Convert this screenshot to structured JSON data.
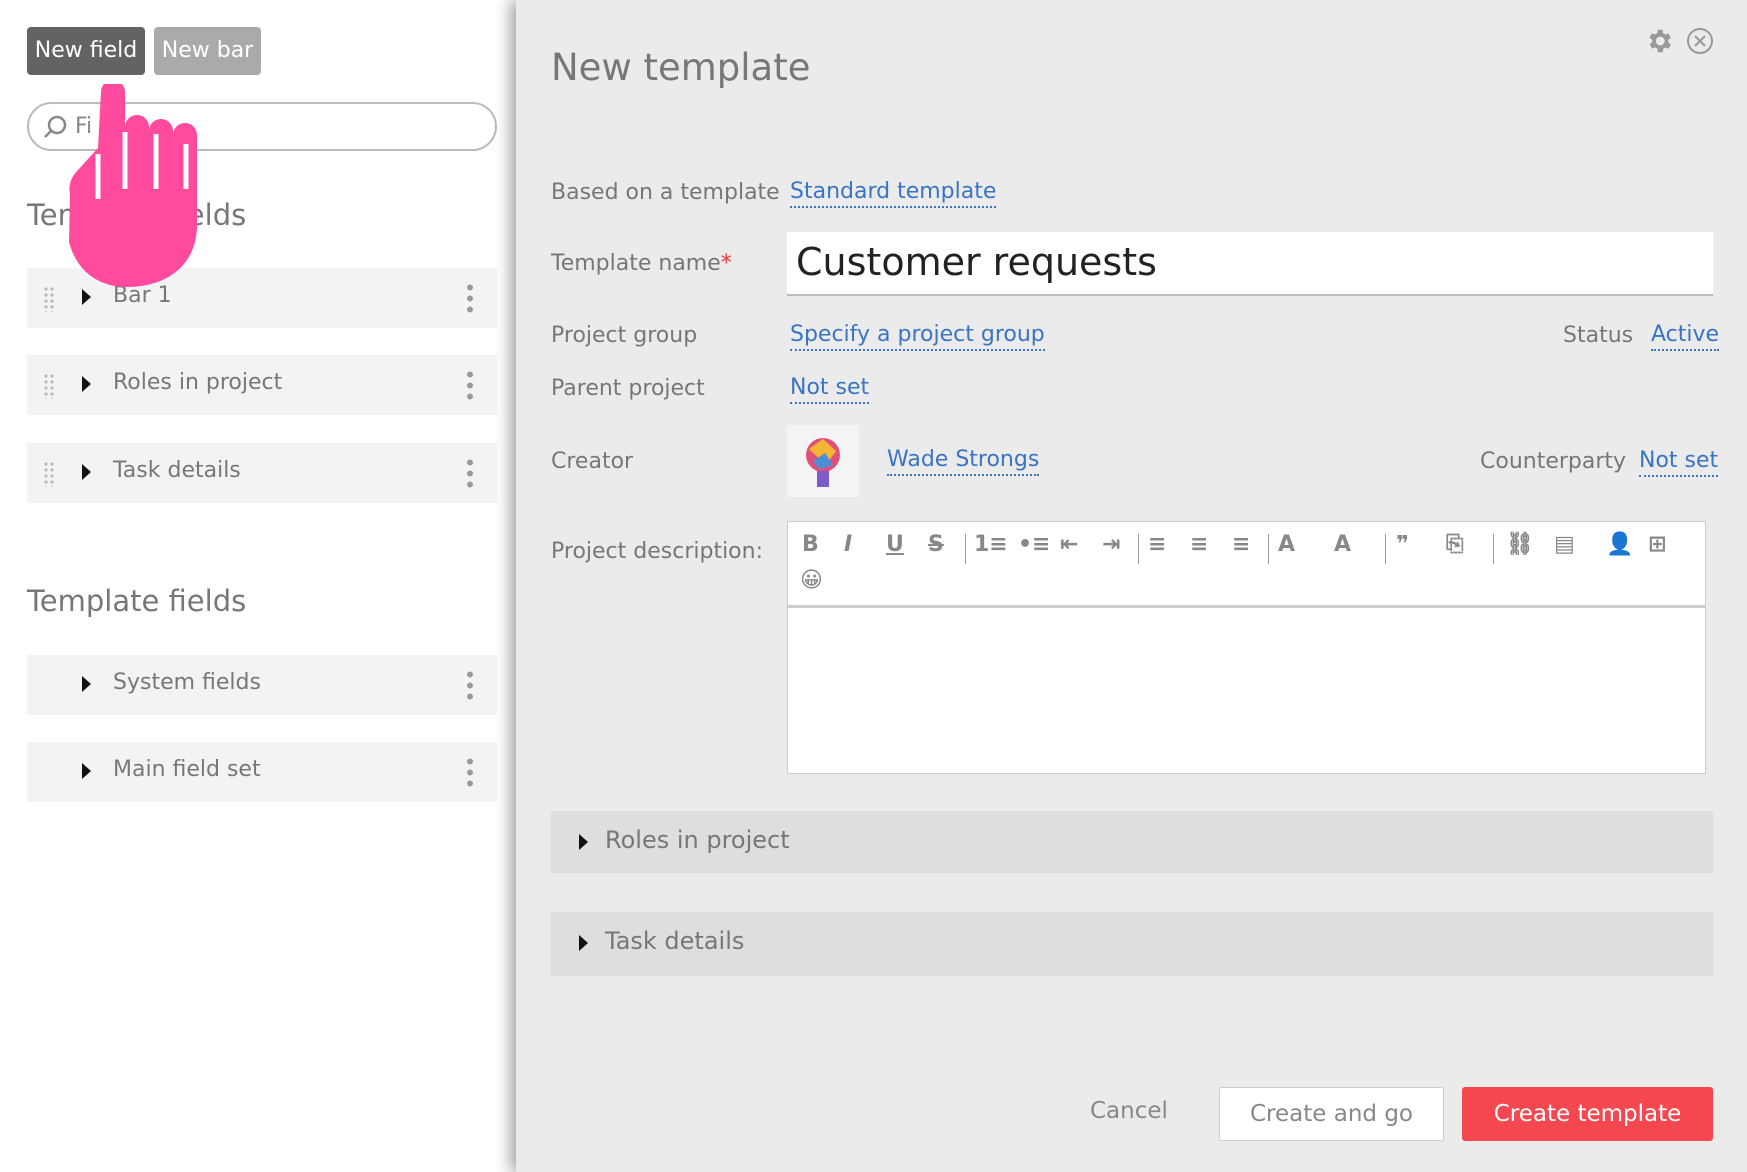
{
  "sidebar": {
    "new_field": "New field",
    "new_bar": "New bar",
    "search_placeholder": "Fi",
    "bars_heading": "Template fields",
    "bars": [
      {
        "label": "Bar 1"
      },
      {
        "label": "Roles in project"
      },
      {
        "label": "Task details"
      }
    ],
    "fields_heading": "Template fields",
    "fields": [
      {
        "label": "System fields"
      },
      {
        "label": "Main field set"
      }
    ]
  },
  "modal": {
    "title": "New template",
    "based_on_label": "Based on a template",
    "based_on_value": "Standard template",
    "name_label": "Template name",
    "required_mark": "*",
    "name_value": "Customer requests",
    "group_label": "Project group",
    "group_value": "Specify a project group",
    "status_label": "Status",
    "status_value": "Active",
    "parent_label": "Parent project",
    "parent_value": "Not set",
    "creator_label": "Creator",
    "creator_value": "Wade Strongs",
    "counterparty_label": "Counterparty",
    "counterparty_value": "Not set",
    "description_label": "Project description:",
    "toolbar": [
      "B",
      "I",
      "U",
      "S",
      "1≡",
      "•≡",
      "⇤",
      "⇥",
      "≡",
      "≡",
      "≡",
      "A",
      "A",
      "❞",
      "⎘",
      "⛓",
      "▤",
      "👤",
      "⊞",
      "😀"
    ],
    "sections": [
      {
        "label": "Roles in project"
      },
      {
        "label": "Task details"
      }
    ],
    "cancel": "Cancel",
    "create_and_go": "Create and go",
    "create": "Create template"
  },
  "colors": {
    "accent": "#f5474f",
    "link": "#3a74c4",
    "cursor": "#ff4a9e"
  }
}
